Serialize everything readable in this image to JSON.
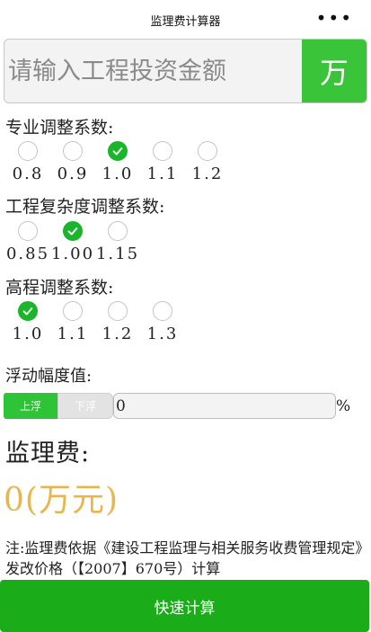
{
  "header": {
    "title": "监理费计算器",
    "more": "•••"
  },
  "amount": {
    "placeholder": "请输入工程投资金额",
    "value": "",
    "unit": "万"
  },
  "professional": {
    "label": "专业调整系数:",
    "options": [
      "0.8",
      "0.9",
      "1.0",
      "1.1",
      "1.2"
    ],
    "selected": "1.0"
  },
  "complexity": {
    "label": "工程复杂度调整系数:",
    "options": [
      "0.85",
      "1.00",
      "1.15"
    ],
    "selected": "1.00"
  },
  "elevation": {
    "label": "高程调整系数:",
    "options": [
      "1.0",
      "1.1",
      "1.2",
      "1.3"
    ],
    "selected": "1.0"
  },
  "float": {
    "label": "浮动幅度值:",
    "up_label": "上浮",
    "down_label": "下浮",
    "value": "0",
    "unit": "%"
  },
  "result": {
    "label": "监理费:",
    "value": "0(万元)"
  },
  "note": "注:监理费依据《建设工程监理与相关服务收费管理规定》发改价格（【2007】670号）计算",
  "footer": {
    "calc_label": "快速计算"
  },
  "colors": {
    "accent": "#1aad19",
    "result": "#e8b64a",
    "unit_bg": "#39c43a"
  }
}
